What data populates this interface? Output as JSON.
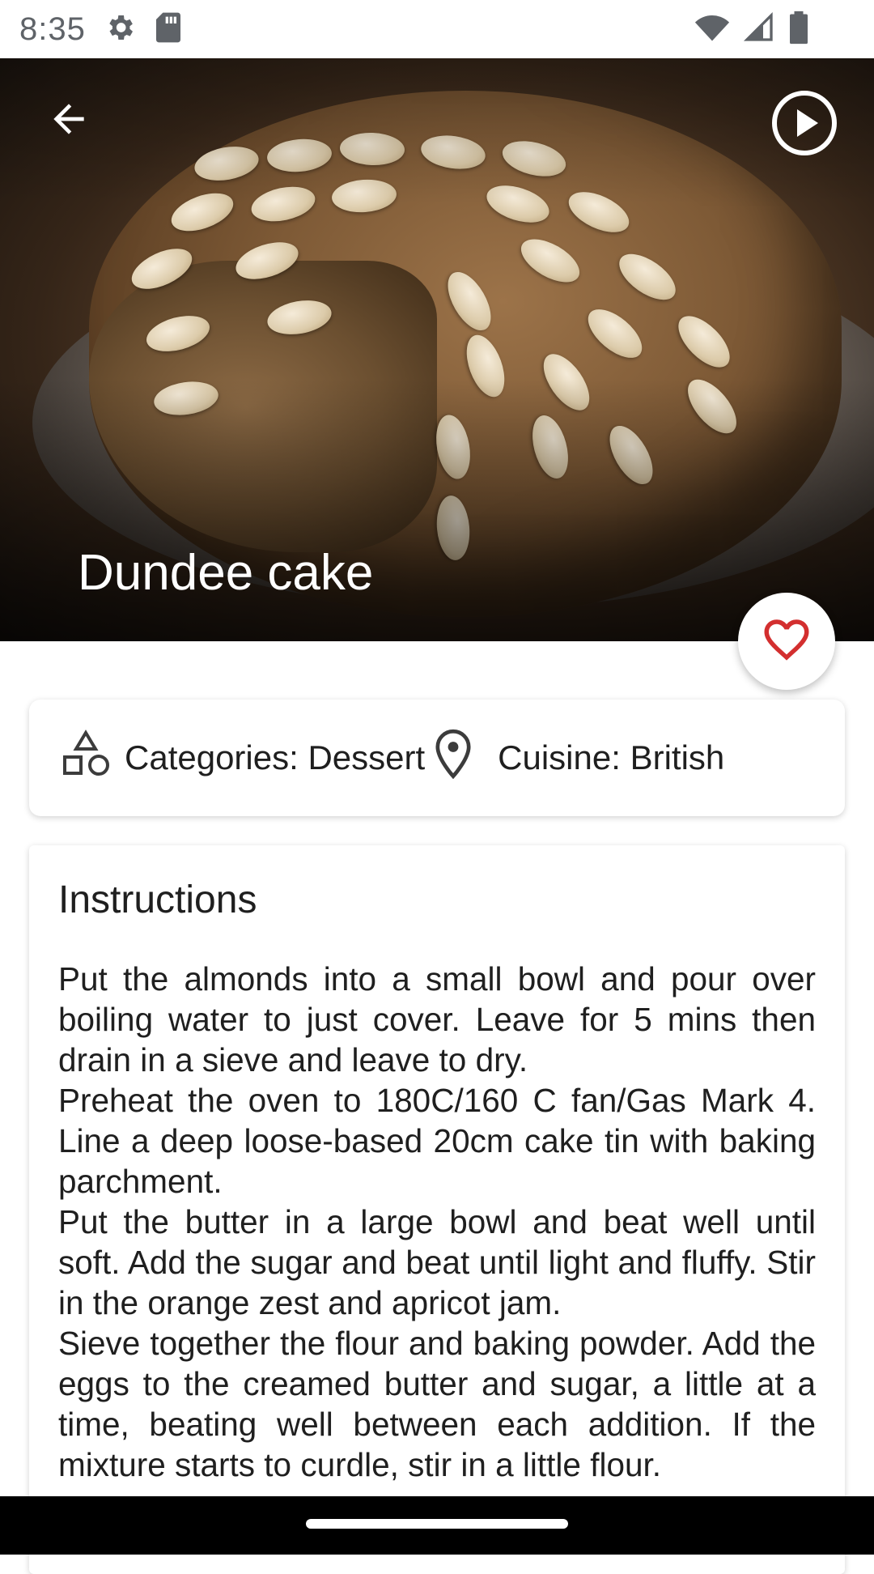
{
  "status_bar": {
    "time": "8:35",
    "icons": [
      "settings-icon",
      "sd-card-icon",
      "wifi-icon",
      "signal-icon",
      "battery-icon"
    ]
  },
  "header": {
    "title": "Dundee cake",
    "back_icon": "arrow-back-icon",
    "play_icon": "play-circle-icon"
  },
  "favorite": {
    "icon": "heart-outline-icon",
    "color": "#d32f2f"
  },
  "info": {
    "categories_label": "Categories: Dessert",
    "cuisine_label": "Cuisine: British",
    "categories_icon": "shapes-icon",
    "cuisine_icon": "location-pin-icon"
  },
  "instructions": {
    "title": "Instructions",
    "paragraphs": [
      "Put the almonds into a small bowl and pour over boiling water to just cover. Leave for 5 mins then drain in a sieve and leave to dry.",
      "Preheat the oven to 180C/160 C fan/Gas Mark 4. Line a deep loose-based 20cm cake tin with baking parchment.",
      "Put the butter in a large bowl and beat well until soft. Add the sugar and beat until light and fluffy. Stir in the orange zest and apricot jam.",
      "Sieve together the flour and baking powder. Add the eggs to the creamed butter and sugar, a little at a time, beating well between each addition. If the mixture starts to curdle, stir in a little flour."
    ]
  }
}
